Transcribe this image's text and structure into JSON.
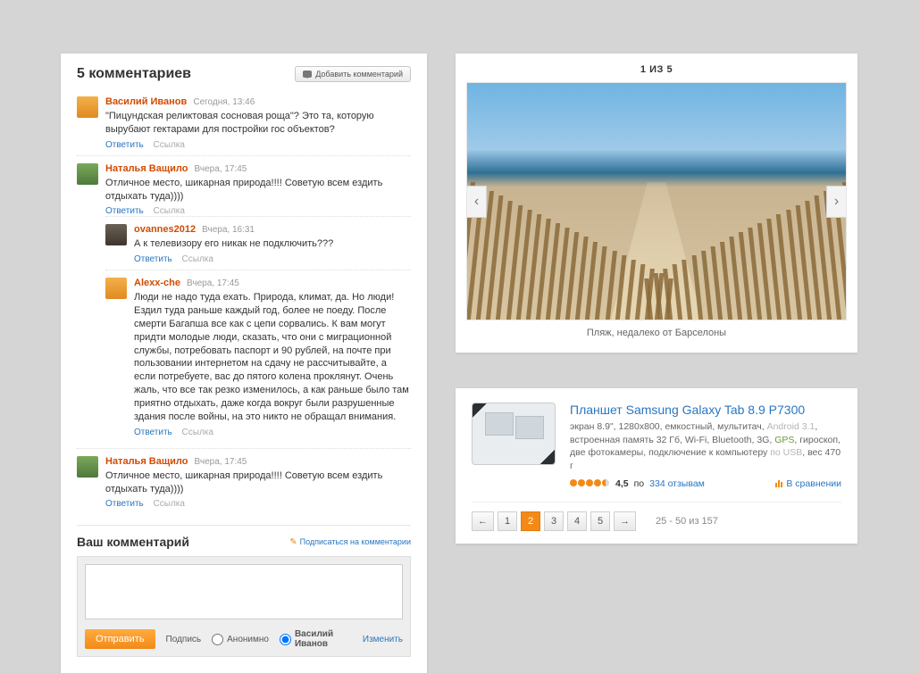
{
  "comments": {
    "heading": "5 комментариев",
    "add_label": "Добавить комментарий",
    "reply_label": "Ответить",
    "permalink_label": "Ссылка",
    "items": [
      {
        "author": "Василий Иванов",
        "ts": "Сегодня, 13:46",
        "text": "\"Пицундская реликтовая сосновая роща\"? Это та, которую вырубают гектарами для постройки гос объектов?"
      },
      {
        "author": "Наталья Ващило",
        "ts": "Вчера, 17:45",
        "text": "Отличное место, шикарная природа!!!! Советую всем ездить отдыхать туда))))"
      },
      {
        "author": "ovannes2012",
        "ts": "Вчера, 16:31",
        "text": "А к телевизору его никак не подключить???"
      },
      {
        "author": "Alexx-che",
        "ts": "Вчера, 17:45",
        "text": "Люди не надо туда ехать. Природа, климат, да. Но люди! Ездил туда раньше каждый год, более не поеду. После смерти Багапша все как с цепи сорвались. К вам могут придти молодые люди, сказать, что они с миграционной службы, потребовать паспорт и 90 рублей, на почте при пользовании интернетом на сдачу не рассчитывайте, а если потребуете, вас до пятого колена проклянут. Очень жаль, что все так резко изменилось, а как раньше было там приятно отдыхать, даже когда вокруг были разрушенные здания после войны, на это никто не обращал внимания."
      },
      {
        "author": "Наталья Ващило",
        "ts": "Вчера, 17:45",
        "text": "Отличное место, шикарная природа!!!! Советую всем ездить отдыхать туда))))"
      }
    ],
    "form": {
      "heading": "Ваш комментарий",
      "subscribe_label": "Подписаться на комментарии",
      "send_label": "Отправить",
      "sign_label": "Подпись",
      "anon_label": "Анонимно",
      "named_label": "Василий Иванов",
      "change_label": "Изменить"
    }
  },
  "gallery": {
    "counter": "1 ИЗ 5",
    "caption": "Пляж, недалеко от Барселоны"
  },
  "product": {
    "title": "Планшет Samsung Galaxy Tab 8.9 P7300",
    "desc_pre": "экран 8.9\", 1280x800, емкостный, мультитач, ",
    "android": "Android 3.1",
    "desc_mid": ", встроенная память 32 Гб, Wi-Fi, Bluetooth, 3G, ",
    "gps": "GPS",
    "desc_post": ", гироскоп, две фотокамеры, подключение к компьютеру ",
    "usb": "по USB",
    "weight": ", вес 470 г",
    "rating_value": "4,5",
    "rating_sep": " по ",
    "reviews": "334 отзывам",
    "compare": "В сравнении",
    "pager": {
      "p1": "1",
      "p2": "2",
      "p3": "3",
      "p4": "4",
      "p5": "5",
      "info": "25 - 50 из 157"
    }
  }
}
